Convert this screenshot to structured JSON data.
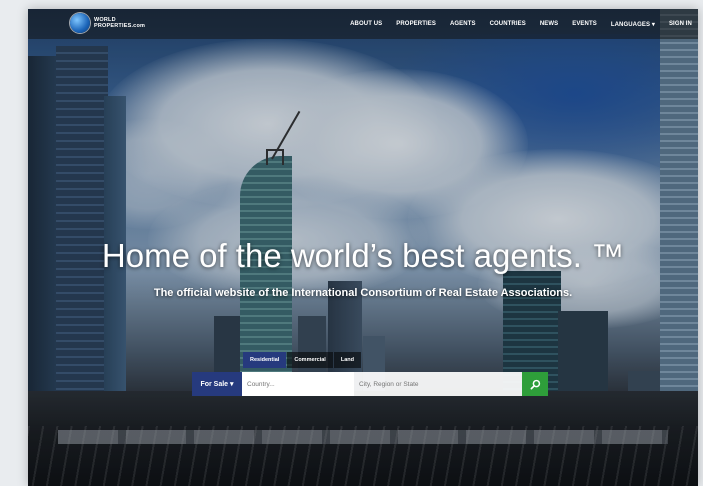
{
  "brand": {
    "name_line1": "WORLD",
    "name_line2": "PROPERTIES.com"
  },
  "nav": {
    "items": [
      "ABOUT US",
      "PROPERTIES",
      "AGENTS",
      "COUNTRIES",
      "NEWS",
      "EVENTS",
      "LANGUAGES ▾",
      "SIGN IN"
    ]
  },
  "hero": {
    "headline": "Home of the world’s best agents. ™",
    "tagline": "The official website of the International Consortium of Real Estate Associations."
  },
  "search": {
    "tabs": [
      "Residential",
      "Commercial",
      "Land"
    ],
    "active_tab": "Residential",
    "mode_label": "For Sale ▾",
    "country_placeholder": "Country...",
    "city_placeholder": "City, Region or State",
    "go_icon": "search-icon"
  },
  "colors": {
    "accent_blue": "#263a7e",
    "search_green": "#2e9e3a"
  }
}
